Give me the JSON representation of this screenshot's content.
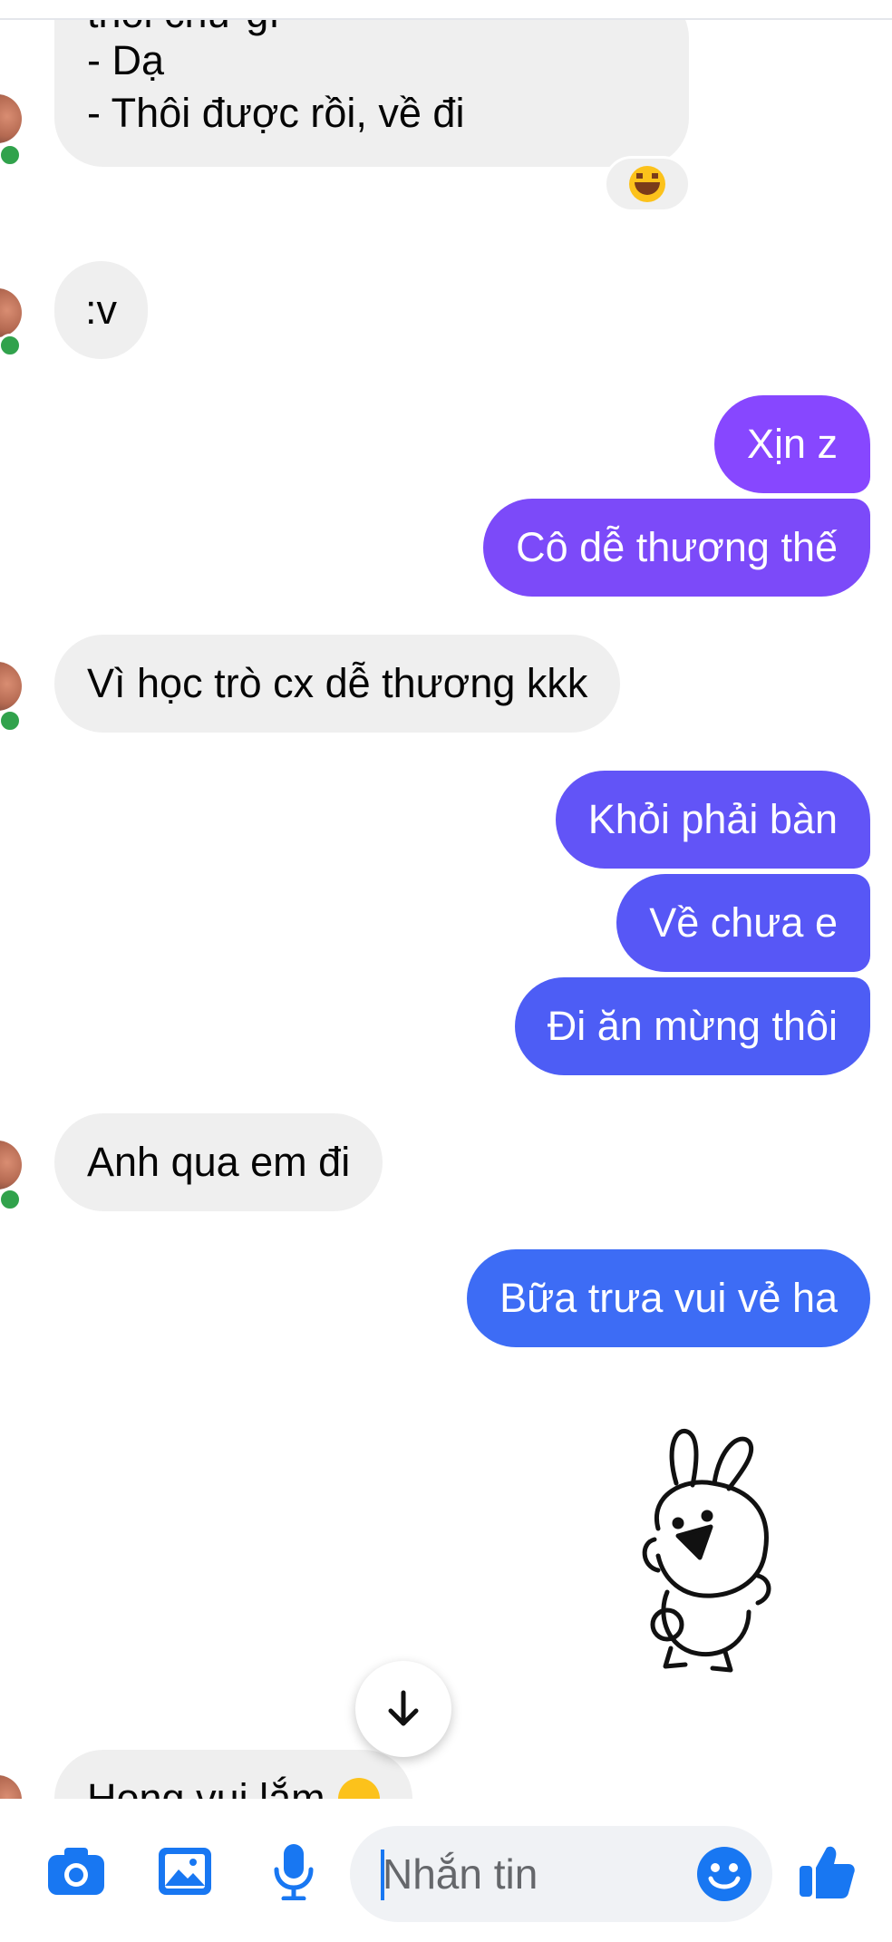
{
  "conversation": {
    "messages": [
      {
        "side": "in",
        "lines": [
          "thôi chứ gì",
          "- Dạ",
          "- Thôi được rồi, về đi"
        ]
      },
      {
        "side": "in",
        "text": ":v"
      },
      {
        "side": "out",
        "text": "Xịn z"
      },
      {
        "side": "out",
        "text": "Cô dễ thương thế"
      },
      {
        "side": "in",
        "text": "Vì học trò cx dễ thương kkk"
      },
      {
        "side": "out",
        "text": "Khỏi phải bàn"
      },
      {
        "side": "out",
        "text": "Về chưa e"
      },
      {
        "side": "out",
        "text": "Đi ăn mừng thôi"
      },
      {
        "side": "in",
        "text": "Anh qua em đi"
      },
      {
        "side": "out",
        "text": "Bữa trưa vui vẻ ha"
      },
      {
        "side": "out",
        "sticker": "bunny-sticker"
      },
      {
        "side": "in",
        "text": "Hong vui lắm"
      }
    ],
    "reaction_icon": "laughing-emoji-icon"
  },
  "composer": {
    "placeholder": "Nhắn tin",
    "icons": [
      "camera-icon",
      "gallery-icon",
      "microphone-icon",
      "emoji-icon",
      "like-icon"
    ]
  },
  "colors": {
    "incoming_bubble": "#efefef",
    "outgoing_top": "#8a44ff",
    "outgoing_bottom": "#3f6ff5",
    "accent": "#1877f2",
    "online": "#31a24c"
  }
}
